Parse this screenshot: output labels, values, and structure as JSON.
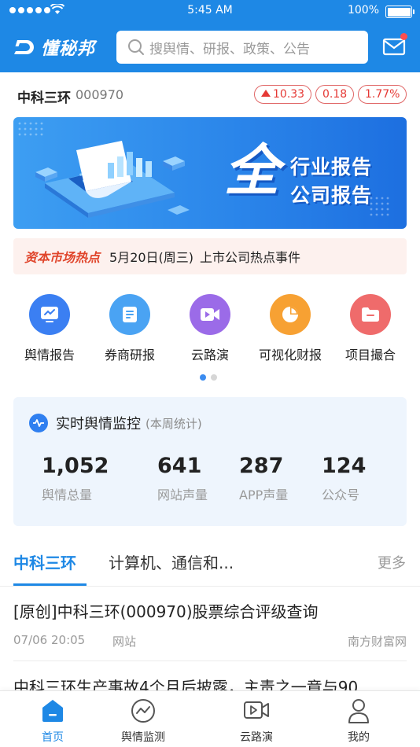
{
  "status_bar": {
    "time": "5:45 AM",
    "battery": "100%"
  },
  "header": {
    "logo_text": "懂秘邦",
    "search_placeholder": "搜舆情、研报、政策、公告"
  },
  "stock": {
    "name": "中科三环",
    "code": "000970",
    "price": "10.33",
    "change": "0.18",
    "change_pct": "1.77%"
  },
  "banner": {
    "big_char": "全",
    "line1": "行业报告",
    "line2": "公司报告"
  },
  "hot": {
    "tag": "资本市场热点",
    "date": "5月20日(周三)",
    "text": "上市公司热点事件"
  },
  "features": [
    {
      "label": "舆情报告",
      "icon": "report-icon",
      "color": "#3b7ff2"
    },
    {
      "label": "券商研报",
      "icon": "document-icon",
      "color": "#4aa3f3"
    },
    {
      "label": "云路演",
      "icon": "video-icon",
      "color": "#9b6be8"
    },
    {
      "label": "可视化财报",
      "icon": "pie-chart-icon",
      "color": "#f7a133"
    },
    {
      "label": "项目撮合",
      "icon": "folder-icon",
      "color": "#ef6b6b"
    }
  ],
  "monitor": {
    "title": "实时舆情监控",
    "subtitle": "(本周统计)",
    "stats": [
      {
        "value": "1,052",
        "label": "舆情总量"
      },
      {
        "value": "641",
        "label": "网站声量"
      },
      {
        "value": "287",
        "label": "APP声量"
      },
      {
        "value": "124",
        "label": "公众号"
      }
    ]
  },
  "tabs": {
    "items": [
      "中科三环",
      "计算机、通信和..."
    ],
    "more": "更多"
  },
  "news": [
    {
      "title": "[原创]中科三环(000970)股票综合评级查询",
      "time": "07/06 20:05",
      "source_type": "网站",
      "site": "南方财富网"
    },
    {
      "title": "中科三环生产事故4个月后披露，主责之一竟与90"
    }
  ],
  "tabbar": [
    {
      "label": "首页",
      "icon": "home-icon"
    },
    {
      "label": "舆情监测",
      "icon": "trend-icon"
    },
    {
      "label": "云路演",
      "icon": "video-icon"
    },
    {
      "label": "我的",
      "icon": "user-icon"
    }
  ],
  "colors": {
    "primary": "#1e88e5",
    "up": "#e53935",
    "hot_tag": "#e0452b"
  }
}
